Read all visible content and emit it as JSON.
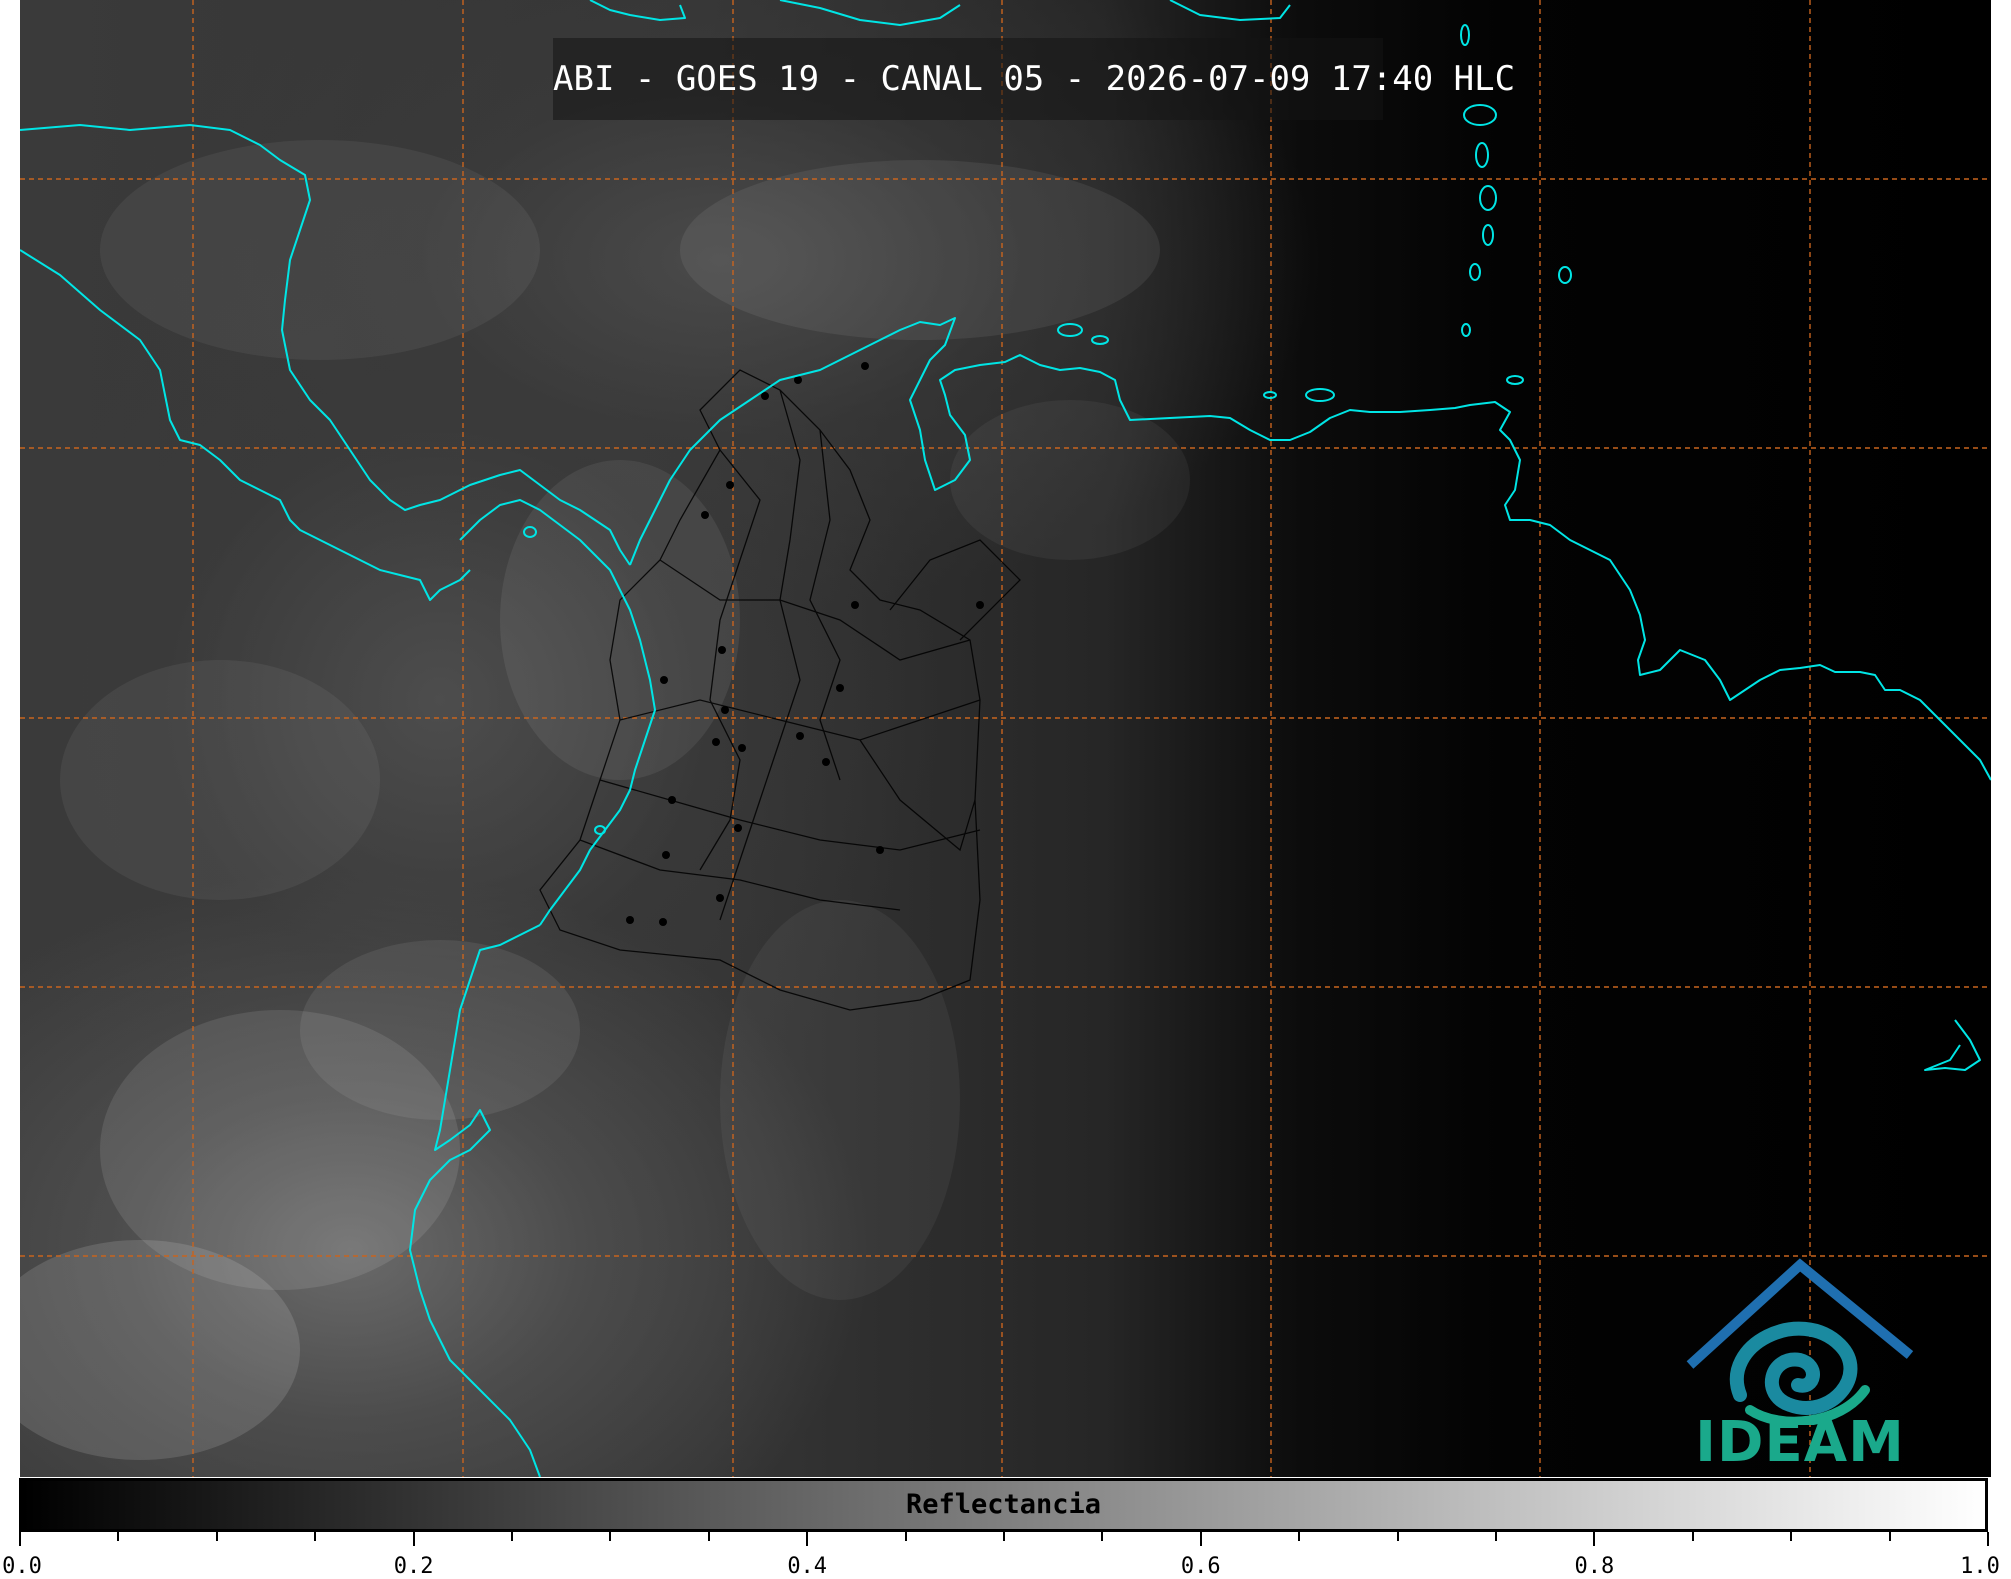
{
  "title": "ABI - GOES 19 - CANAL 05 - 2026-07-09 17:40 HLC",
  "colors": {
    "coastline": "#00e5e5",
    "grid": "#c8641e",
    "borders": "#000000",
    "logo_blue": "#1f6fb0",
    "logo_green": "#1aa98b"
  },
  "logo": {
    "text": "IDEAM"
  },
  "colorbar": {
    "label": "Reflectancia",
    "min": 0.0,
    "max": 1.0,
    "tick_labels": [
      "0.0",
      "0.2",
      "0.4",
      "0.6",
      "0.8",
      "1.0"
    ]
  }
}
